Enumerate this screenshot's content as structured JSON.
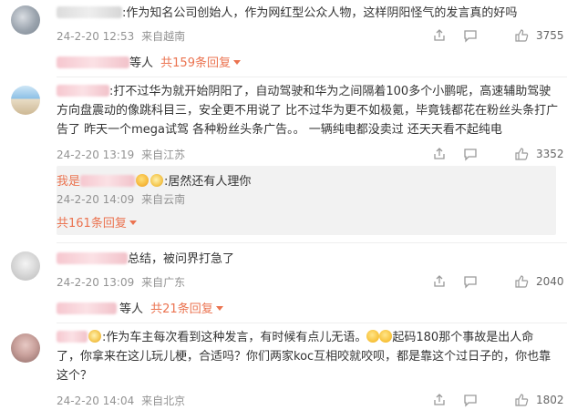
{
  "comments": [
    {
      "text": ":作为知名公司创始人，作为网红型公众人物，这样阴阳怪气的发言真的好吗",
      "date": "24-2-20 12:53",
      "location": "来自越南",
      "likes": "3755",
      "reply_summary": {
        "tail": "等人",
        "count_label": "共159条回复"
      }
    },
    {
      "text_line1": ":打不过华为就开始阴阳了，自动驾驶和华为之间隔着100多个小鹏呢，高速辅助驾驶",
      "text_line2": "方向盘震动的像跳科目三，安全更不用说了 比不过华为更不如极氪，毕竟钱都花在粉丝头条打广",
      "text_line3": "告了 昨天一个mega试驾 各种粉丝头条广告。。 一辆纯电都没卖过 还天天看不起纯电",
      "date": "24-2-20 13:19",
      "location": "来自江苏",
      "likes": "3352",
      "reply": {
        "name": "我是",
        "text": ":居然还有人理你",
        "date": "24-2-20 14:09",
        "location": "来自云南",
        "count_label": "共161条回复"
      }
    },
    {
      "text": "总结，被问界打急了",
      "date": "24-2-20 13:09",
      "location": "来自广东",
      "likes": "2040",
      "reply_summary": {
        "tail": "等人",
        "count_label": "共21条回复"
      }
    },
    {
      "text_part1": ":作为车主每次看到这种发言，有时候有点儿无语。",
      "text_part2": "起码180那个事故是出人命",
      "text_line2": "了，你拿来在这儿玩儿梗，合适吗？你们两家koc互相咬就咬呗，都是靠这个过日子的，你也靠",
      "text_line3": "这个？",
      "date": "24-2-20 14:04",
      "location": "来自北京",
      "likes": "1802"
    }
  ],
  "icons": [
    "share-icon",
    "comment-icon",
    "like-icon",
    "chevron-down-icon"
  ],
  "colors": {
    "link": "#eb7350",
    "meta": "#939393",
    "reply_bg": "#f2f2f2"
  }
}
